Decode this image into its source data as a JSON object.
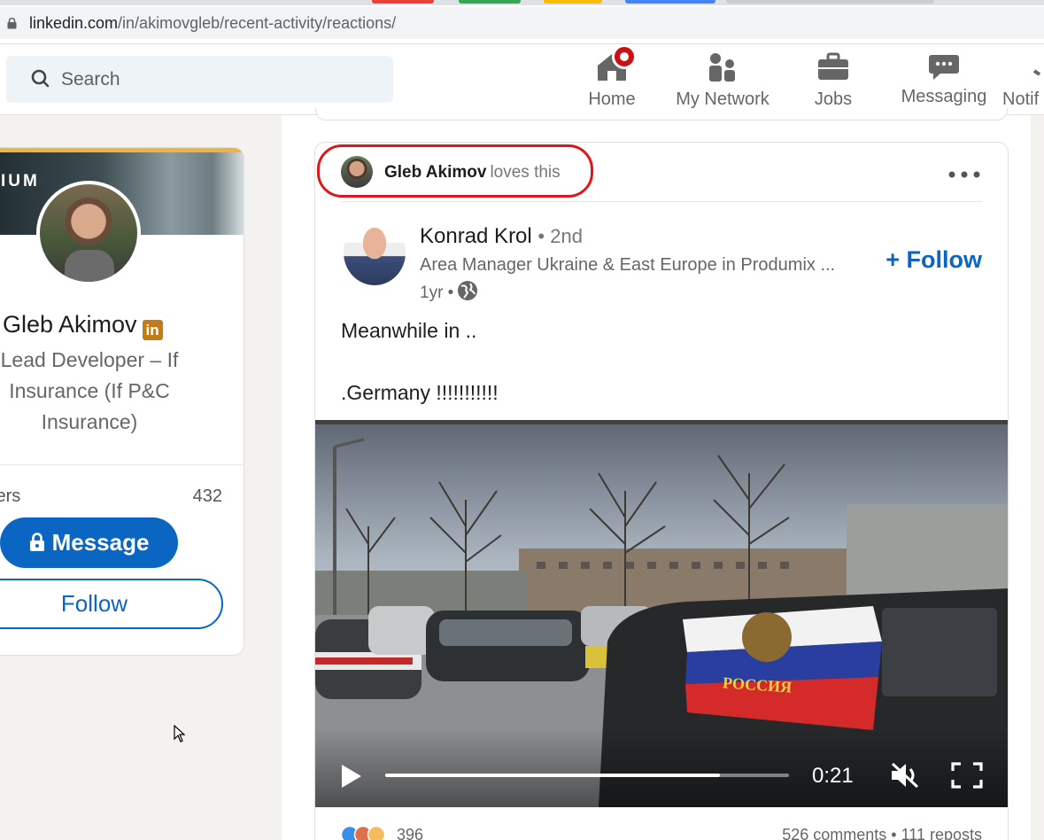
{
  "browser": {
    "url_host": "linkedin.com",
    "url_path": "/in/akimovgleb/recent-activity/reactions/"
  },
  "nav": {
    "search_placeholder": "Search",
    "items": [
      {
        "label": "Home",
        "icon": "home-icon"
      },
      {
        "label": "My Network",
        "icon": "people-icon"
      },
      {
        "label": "Jobs",
        "icon": "briefcase-icon"
      },
      {
        "label": "Messaging",
        "icon": "chat-icon"
      },
      {
        "label": "Notif",
        "icon": "bell-icon"
      }
    ]
  },
  "profile": {
    "banner_text": "IUM",
    "name": "Gleb Akimov",
    "badge": "in",
    "headline": "Lead Developer – If Insurance (If P&C Insurance)",
    "followers_label": "wers",
    "followers_count": "432",
    "message_label": "Message",
    "follow_label": "Follow"
  },
  "post": {
    "reactor_name": "Gleb Akimov",
    "reaction_verb": "loves this",
    "author": {
      "name": "Konrad Krol",
      "degree": "• 2nd",
      "title": "Area Manager Ukraine & East Europe in Produmix ...",
      "time": "1yr •"
    },
    "follow_label": "+ Follow",
    "text_line1": "Meanwhile in ..",
    "text_line2": ".Germany !!!!!!!!!!!",
    "video": {
      "time": "0:21",
      "progress": 0.83,
      "flag_text": "РОССИЯ"
    },
    "reactions_count": "396",
    "comments_reposts": "526 comments • 111 reposts"
  },
  "colors": {
    "linkedin_blue": "#0a66c2",
    "annotation_red": "#e3141b",
    "premium_gold": "#c37d16"
  }
}
